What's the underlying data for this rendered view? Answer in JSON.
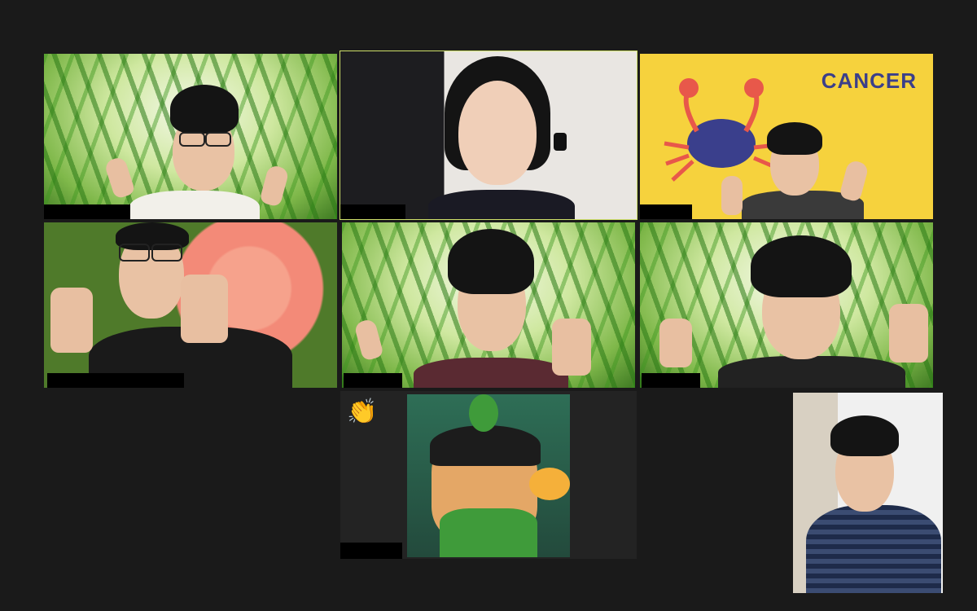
{
  "gallery": {
    "tiles": [
      {
        "id": "p1",
        "name": ""
      },
      {
        "id": "p2",
        "name": ""
      },
      {
        "id": "p3",
        "name": "",
        "background_text": "CANCER"
      },
      {
        "id": "p4",
        "name": ""
      },
      {
        "id": "p5",
        "name": ""
      },
      {
        "id": "p6",
        "name": ""
      },
      {
        "id": "p7",
        "name": "",
        "reaction": "👏"
      },
      {
        "id": "p8",
        "name": ""
      }
    ]
  },
  "colors": {
    "background": "#1a1a1a",
    "active_speaker_border": "#cfe06a",
    "cancer_bg": "#f6d23d",
    "cancer_text": "#3b3f8a"
  }
}
